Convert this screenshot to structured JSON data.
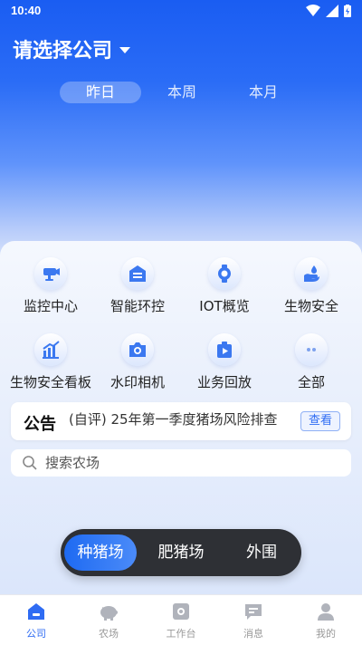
{
  "status_bar": {
    "time": "10:40"
  },
  "header": {
    "company_select": "请选择公司"
  },
  "period_tabs": [
    {
      "label": "昨日",
      "active": true
    },
    {
      "label": "本周",
      "active": false
    },
    {
      "label": "本月",
      "active": false
    }
  ],
  "functions": [
    {
      "label": "监控中心",
      "icon": "camera-icon"
    },
    {
      "label": "智能环控",
      "icon": "house-control-icon"
    },
    {
      "label": "IOT概览",
      "icon": "iot-watch-icon"
    },
    {
      "label": "生物安全",
      "icon": "hand-drop-icon"
    },
    {
      "label": "生物安全看板",
      "icon": "bar-chart-icon"
    },
    {
      "label": "水印相机",
      "icon": "photo-camera-icon"
    },
    {
      "label": "业务回放",
      "icon": "playback-icon"
    },
    {
      "label": "全部",
      "icon": "more-dots-icon"
    }
  ],
  "notice": {
    "title": "公告",
    "text": "(自评) 25年第一季度猪场风险排查",
    "button": "查看"
  },
  "search": {
    "placeholder": "搜索农场"
  },
  "farm_types": [
    {
      "label": "种猪场",
      "active": true
    },
    {
      "label": "肥猪场",
      "active": false
    },
    {
      "label": "外围",
      "active": false
    }
  ],
  "bottom_nav": [
    {
      "label": "公司",
      "icon": "home-icon",
      "active": true
    },
    {
      "label": "农场",
      "icon": "pig-icon",
      "active": false
    },
    {
      "label": "工作台",
      "icon": "workbench-icon",
      "active": false
    },
    {
      "label": "消息",
      "icon": "message-icon",
      "active": false
    },
    {
      "label": "我的",
      "icon": "user-icon",
      "active": false
    }
  ],
  "colors": {
    "primary": "#2f6cf3",
    "hero_top": "#1a5df2",
    "switch_bg": "#2e3035"
  }
}
